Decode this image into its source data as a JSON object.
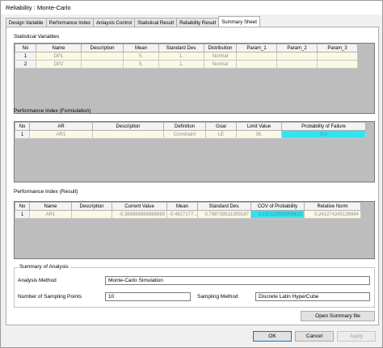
{
  "window": {
    "title": "Reliability : Monte-Carlo"
  },
  "tabs": [
    {
      "label": "Design Variable"
    },
    {
      "label": "Performance Index"
    },
    {
      "label": "Anlaysis Control"
    },
    {
      "label": "Statistical Result"
    },
    {
      "label": "Reliability Result"
    },
    {
      "label": "Summary Sheet"
    }
  ],
  "statistical_variables": {
    "title": "Statistical Variables",
    "columns": [
      "No",
      "Name",
      "Description",
      "Mean",
      "Standard Dev.",
      "Distribution",
      "Param_1",
      "Param_2",
      "Param_3"
    ],
    "rows": [
      [
        "1",
        "DP1",
        "",
        "5.",
        "1.",
        "Normal",
        "",
        "",
        ""
      ],
      [
        "2",
        "DP2",
        "",
        "5.",
        "1.",
        "Normal",
        "",
        "",
        ""
      ]
    ]
  },
  "performance_formulation": {
    "title": "Performance Index (Formulation)",
    "columns": [
      "No",
      "AR",
      "Description",
      "Definition",
      "Goal",
      "Limit Value",
      "Probability of Failure"
    ],
    "rows": [
      [
        "1",
        "AR1",
        "",
        "Constraint",
        "LE",
        "36.",
        "0.0"
      ]
    ]
  },
  "performance_result": {
    "title": "Performance Index (Result)",
    "columns": [
      "No",
      "Name",
      "Description",
      "Current Value",
      "Mean",
      "Standard Dev.",
      "COV of Probability",
      "Relative Norm"
    ],
    "rows": [
      [
        "1",
        "AR1",
        "",
        "-0.388888888888889",
        "-0.4827177...",
        "0.799739511399187",
        "0.150113939306613",
        "0.241274245136964"
      ]
    ]
  },
  "summary": {
    "title": "Summary of Analysis",
    "analysis_method_label": "Analysis Method",
    "analysis_method_value": "Monte-Carlo Simulation",
    "sampling_points_label": "Number of Sampling Points",
    "sampling_points_value": "10",
    "sampling_method_label": "Sampling Method",
    "sampling_method_value": "Discrete Latin HyperCube"
  },
  "buttons": {
    "open_summary": "Open Summary file",
    "ok": "OK",
    "cancel": "Cancel",
    "apply": "Apply"
  },
  "colors": {
    "highlight_cell": "#2ee6f2",
    "readonly_cell": "#fbf8e4",
    "focus_border": "#0078d7"
  }
}
